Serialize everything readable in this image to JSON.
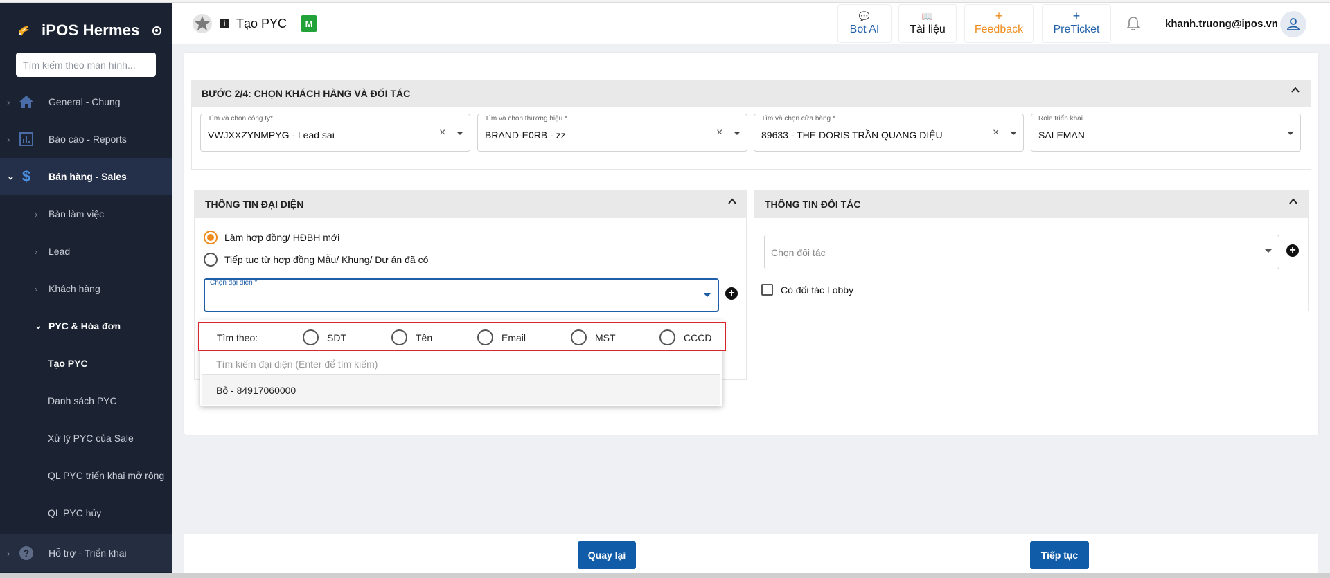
{
  "sidebar": {
    "brand": "iPOS Hermes",
    "search_placeholder": "Tìm kiếm theo màn hình...",
    "items": [
      {
        "label": "General - Chung",
        "icon": "home-icon"
      },
      {
        "label": "Báo cáo - Reports",
        "icon": "bar-chart-icon"
      },
      {
        "label": "Bán hàng - Sales",
        "icon": "dollar-icon"
      },
      {
        "label": "Bàn làm việc"
      },
      {
        "label": "Lead"
      },
      {
        "label": "Khách hàng"
      },
      {
        "label": "PYC & Hóa đơn"
      },
      {
        "label": "Tạo PYC"
      },
      {
        "label": "Danh sách PYC"
      },
      {
        "label": "Xử lý PYC của Sale"
      },
      {
        "label": "QL PYC triển khai mở rộng"
      },
      {
        "label": "QL PYC hủy"
      },
      {
        "label": "Hỗ trợ - Triển khai",
        "icon": "help-icon"
      }
    ]
  },
  "header": {
    "title": "Tạo PYC",
    "badge": "M",
    "buttons": [
      {
        "glyph": "💬",
        "label": "Bot AI",
        "color": "#1f5fa7"
      },
      {
        "glyph": "📖",
        "label": "Tài liệu",
        "color": "#111111"
      },
      {
        "glyph": "+",
        "label": "Feedback",
        "color": "#f08c1e"
      },
      {
        "glyph": "+",
        "label": "PreTicket",
        "color": "#1f5fa7"
      }
    ],
    "user_email": "khanh.truong@ipos.vn"
  },
  "step": {
    "title": "BƯỚC 2/4: CHỌN KHÁCH HÀNG VÀ ĐỐI TÁC",
    "fields": [
      {
        "label": "Tìm và chọn công ty*",
        "value": "VWJXXZYNMPYG - Lead sai"
      },
      {
        "label": "Tìm và chọn thương hiệu *",
        "value": "BRAND-E0RB - zz"
      },
      {
        "label": "Tìm và chọn cửa hàng *",
        "value": "89633 - THE DORIS TRẦN QUANG DIỆU"
      },
      {
        "label": "Role triển khai",
        "value": "SALEMAN"
      }
    ]
  },
  "rep_panel": {
    "title": "THÔNG TIN ĐẠI DIỆN",
    "radio_new": "Làm hợp đồng/ HĐBH mới",
    "radio_continue": "Tiếp tục từ hợp đồng Mẫu/ Khung/ Dự án đã có",
    "rep_label": "Chọn đại diện *",
    "dropdown": {
      "search_by_label": "Tìm theo:",
      "options": [
        "SDT",
        "Tên",
        "Email",
        "MST",
        "CCCD"
      ],
      "search_placeholder": "Tìm kiếm đại diện (Enter để tìm kiếm)",
      "result": "Bỏ - 84917060000"
    }
  },
  "partner_panel": {
    "title": "THÔNG TIN ĐỐI TÁC",
    "placeholder": "Chọn đối tác",
    "checkbox_label": "Có đối tác Lobby"
  },
  "footer": {
    "back": "Quay lại",
    "next": "Tiếp tục"
  },
  "colors": {
    "sidebar_bg": "#1b2333",
    "primary": "#105ca8",
    "accent": "#f08c1e",
    "highlight_border": "#d9262e"
  }
}
